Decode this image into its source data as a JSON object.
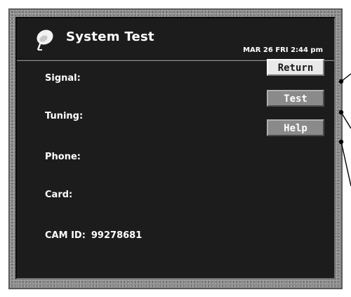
{
  "header": {
    "title": "System Test",
    "datetime": "MAR 26 FRI  2:44 pm",
    "icon": "satellite-dish-icon"
  },
  "fields": {
    "signal_label": "Signal:",
    "tuning_label": "Tuning:",
    "phone_label": "Phone:",
    "card_label": "Card:",
    "cam_id_label": "CAM ID:",
    "cam_id_value": "99278681"
  },
  "buttons": {
    "return_label": "Return",
    "test_label": "Test",
    "help_label": "Help"
  },
  "colors": {
    "screen_bg": "#1c1c1c",
    "frame": "#8d8d8d",
    "button_selected": "#e9e9e9",
    "button_normal": "#8a8a8a"
  }
}
